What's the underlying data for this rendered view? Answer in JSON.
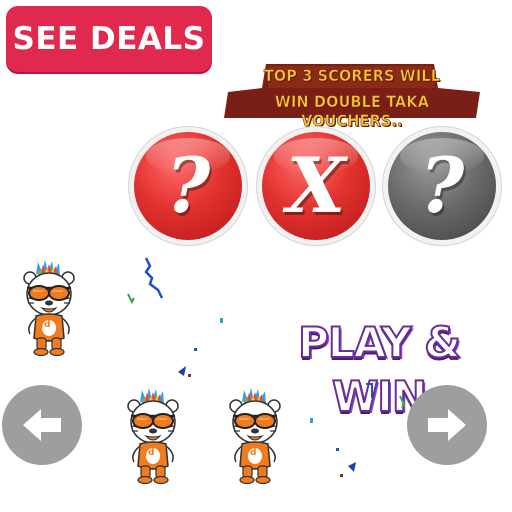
{
  "deals_button": {
    "label": "SEE DEALS",
    "color": "#e0294c"
  },
  "banner": {
    "line1": "TOP 3 SCORERS WILL",
    "line2": "WIN DOUBLE TAKA VOUCHERS..",
    "text_color": "#f7c531",
    "bg_color": "#7a1f15"
  },
  "game_balls": [
    {
      "symbol": "?",
      "color": "red"
    },
    {
      "symbol": "X",
      "color": "red"
    },
    {
      "symbol": "?",
      "color": "grey"
    }
  ],
  "title": "PLAY & WIN",
  "nav": {
    "prev_icon": "arrow-left-icon",
    "next_icon": "arrow-right-icon"
  },
  "mascot_badge": "d",
  "palette": {
    "red": "#e2322e",
    "grey": "#6b6b6b",
    "purple": "#6a2e9a",
    "orange": "#f07c1e"
  }
}
